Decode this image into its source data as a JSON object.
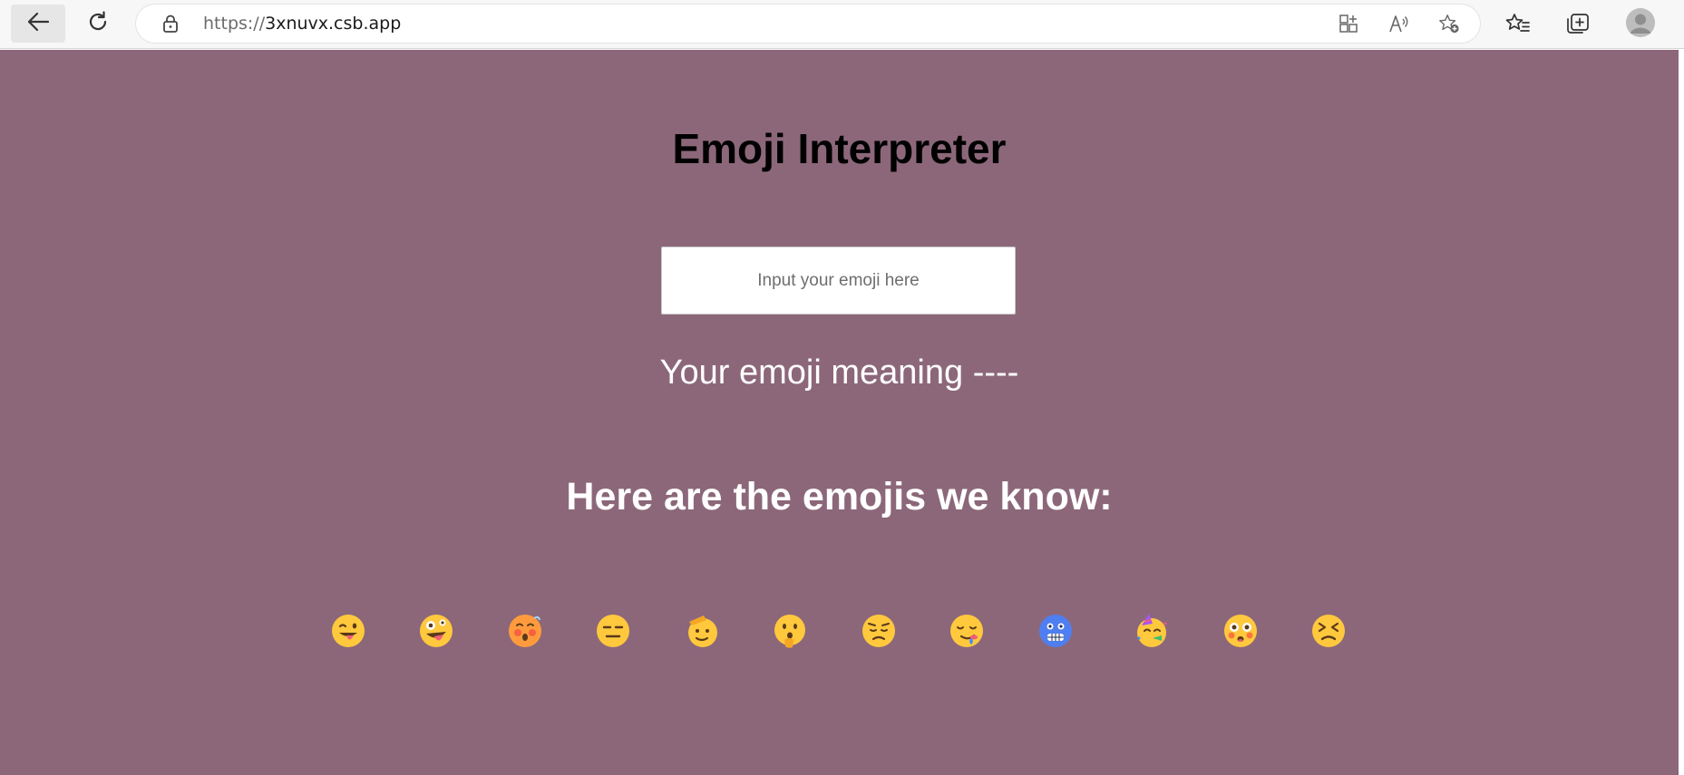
{
  "browser": {
    "url_protocol": "https://",
    "url_host": "3xnuvx.csb.app",
    "icons": [
      "back-arrow-icon",
      "refresh-icon",
      "lock-icon",
      "app-available-icon",
      "read-aloud-icon",
      "add-favorite-icon",
      "favorites-icon",
      "collections-icon",
      "profile-avatar-icon"
    ]
  },
  "page": {
    "background_color": "#8c677a",
    "title": "Emoji Interpreter",
    "input_placeholder": "Input your emoji here",
    "meaning_text": "Your emoji meaning ----",
    "known_heading": "Here are the emojis we know:"
  },
  "emojis": [
    {
      "name": "winking-face-with-tongue"
    },
    {
      "name": "zany-face"
    },
    {
      "name": "face-exhaling-flushed"
    },
    {
      "name": "expressionless-face"
    },
    {
      "name": "saluting-face"
    },
    {
      "name": "face-with-hand-over-mouth"
    },
    {
      "name": "pensive-worried-face"
    },
    {
      "name": "sleepy-drooling-face"
    },
    {
      "name": "cold-face"
    },
    {
      "name": "partying-face"
    },
    {
      "name": "flushed-face"
    },
    {
      "name": "persevering-face"
    }
  ]
}
